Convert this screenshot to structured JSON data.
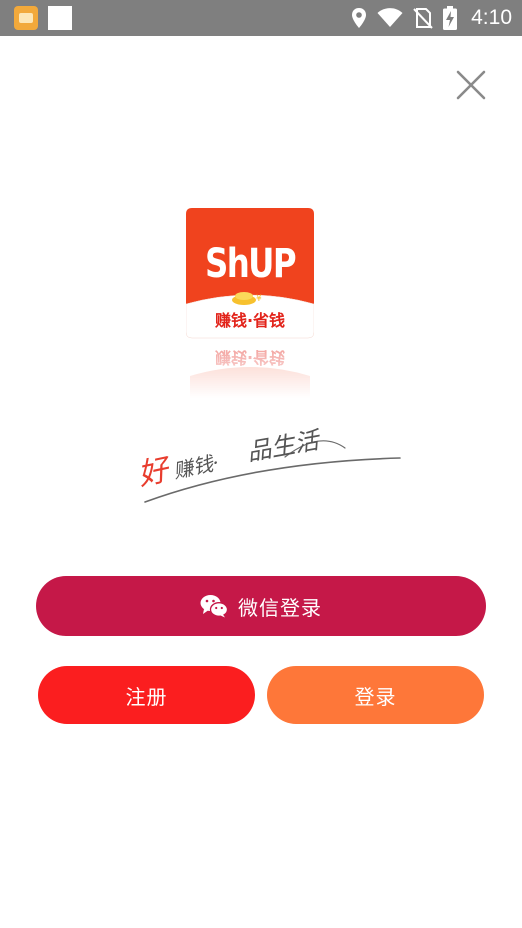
{
  "status_bar": {
    "time": "4:10",
    "icons": [
      "app-notification-icon",
      "blank-notification-icon",
      "location-icon",
      "wifi-icon",
      "no-sim-icon",
      "battery-charging-icon"
    ]
  },
  "header": {
    "close_icon": "close-icon"
  },
  "logo": {
    "wordmark": "ShUP",
    "tagline": "赚钱·省钱",
    "brand_color": "#f0431e"
  },
  "slogan": {
    "left": "好",
    "middle": "赚钱·",
    "right": "品生活"
  },
  "buttons": {
    "wechat_login": "微信登录",
    "register": "注册",
    "login": "登录"
  },
  "colors": {
    "wechat_button": "#c51848",
    "register_button": "#fb1e1f",
    "login_button": "#fe7739",
    "status_bar": "#7f7f7f"
  }
}
